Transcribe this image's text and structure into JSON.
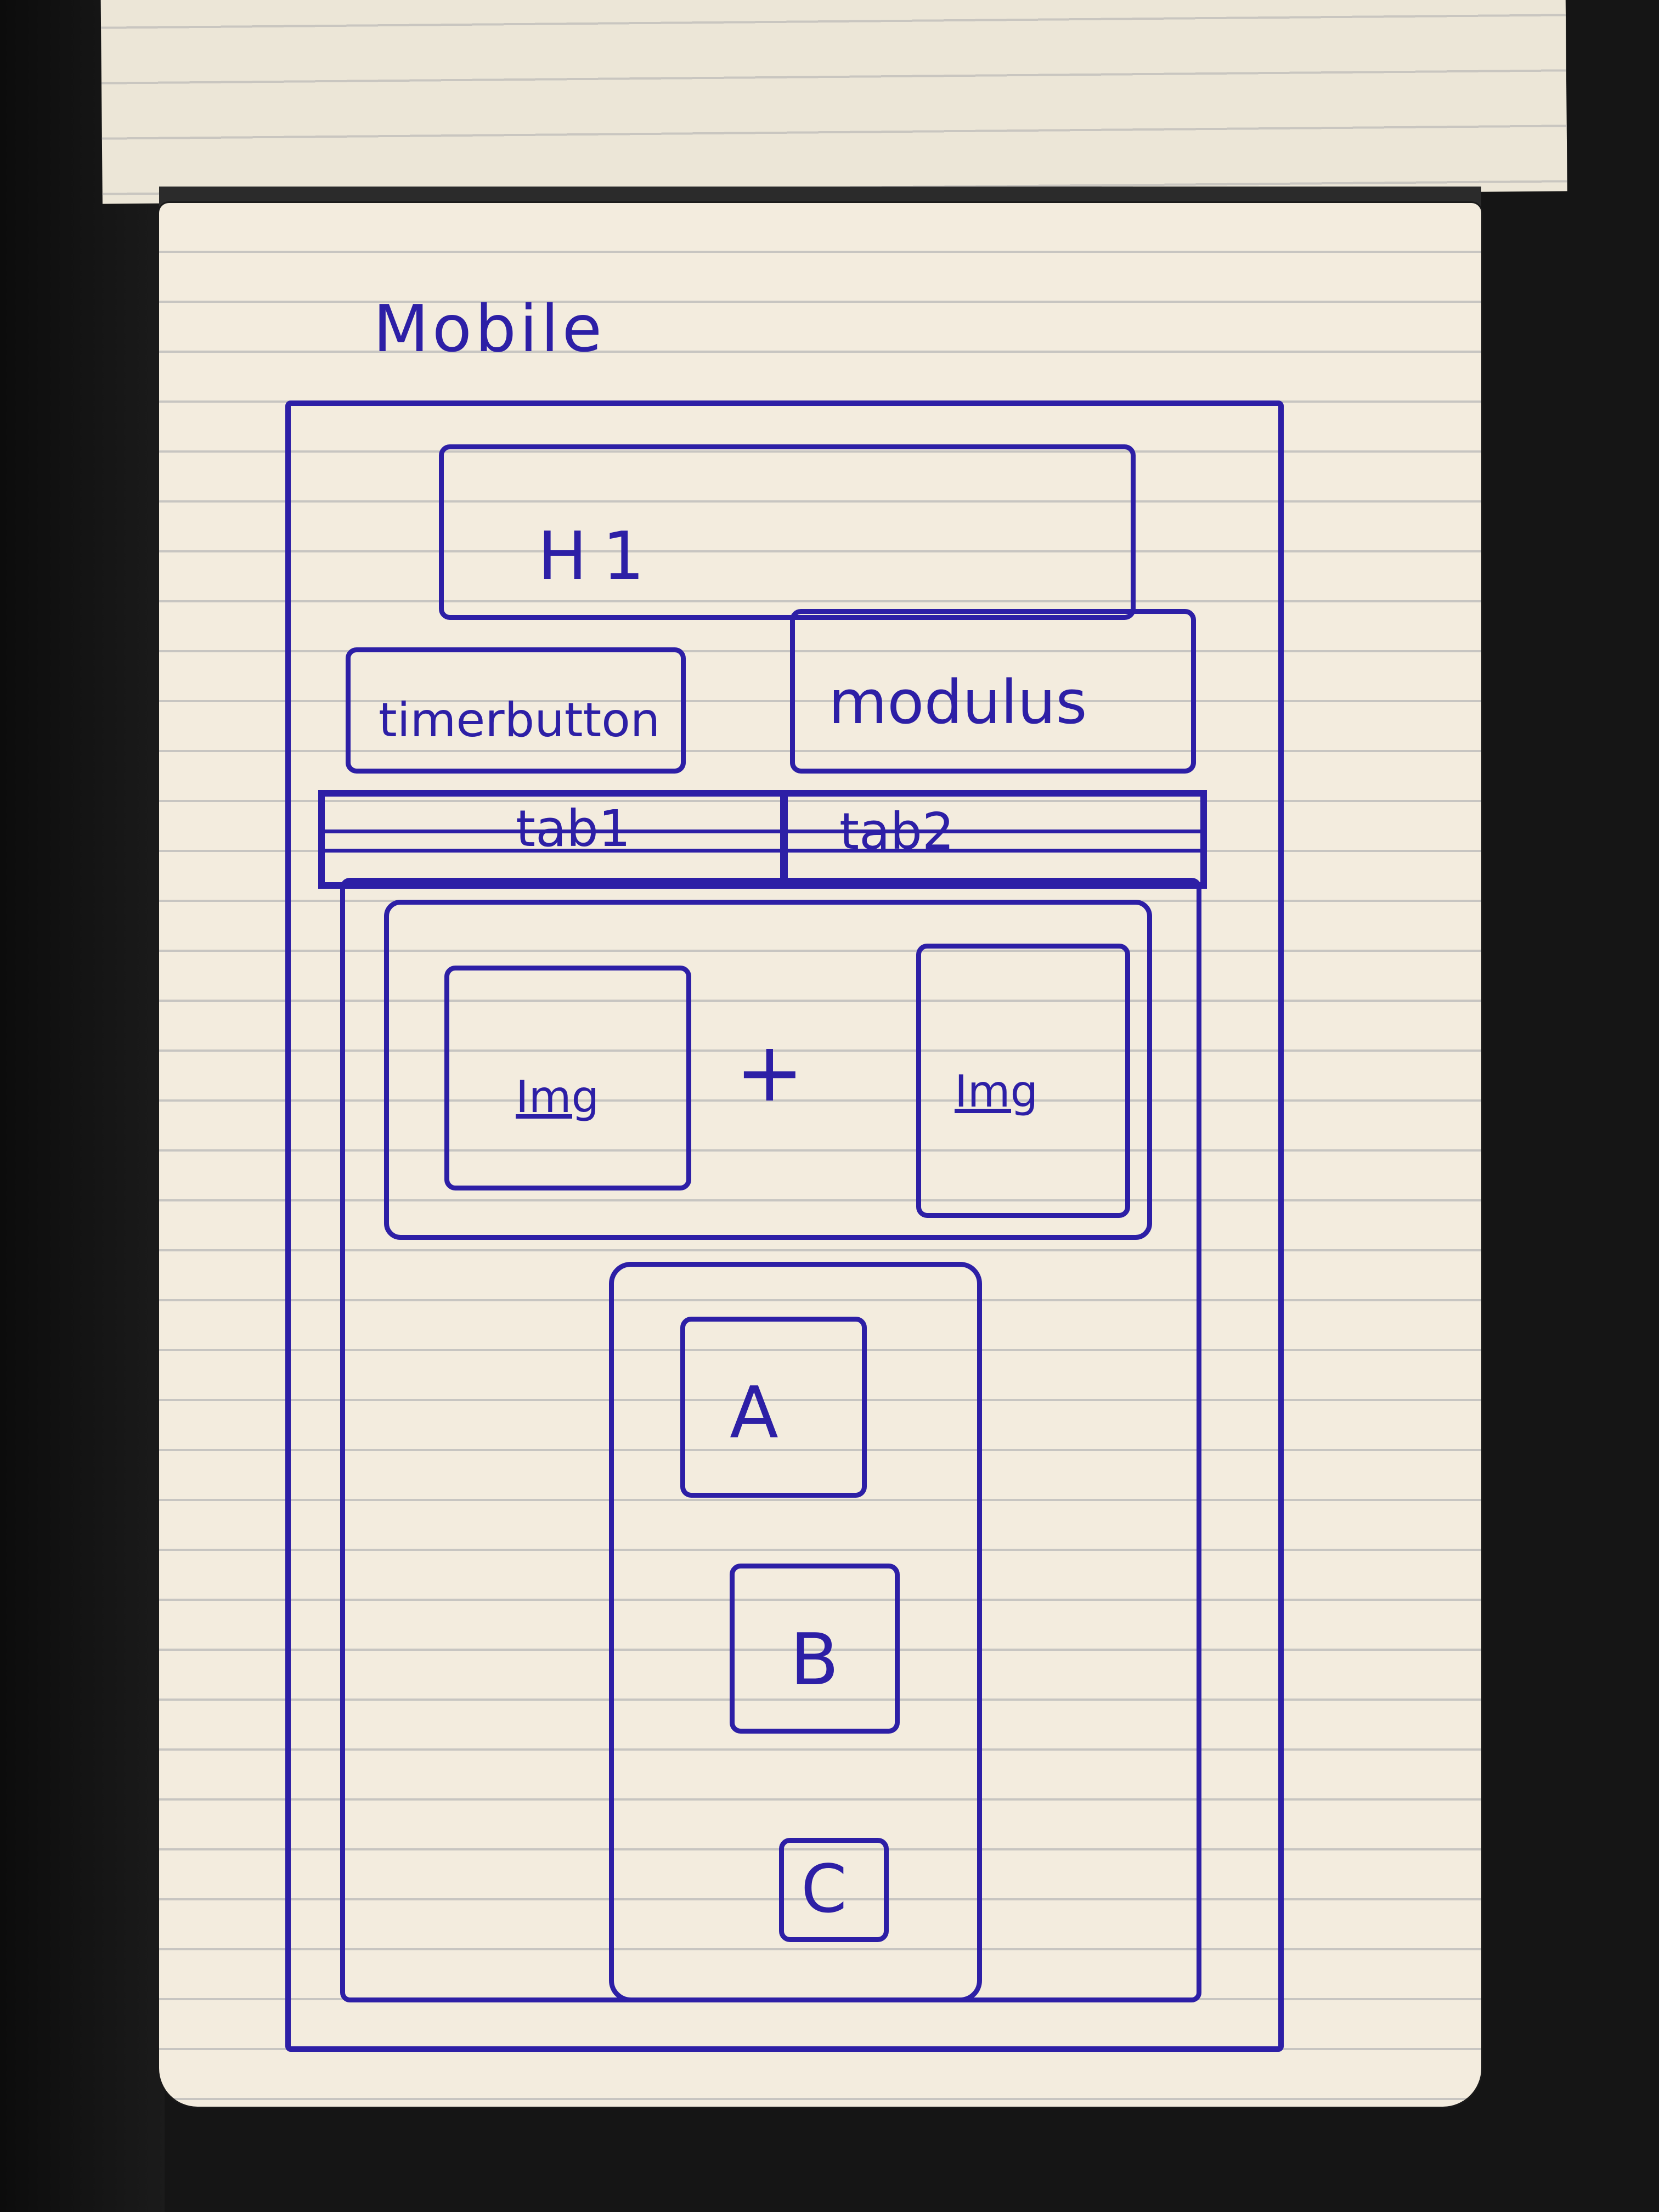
{
  "sketch": {
    "title": "Mobile",
    "header": {
      "label": "H1"
    },
    "buttons": [
      {
        "label": "timerbutton"
      },
      {
        "label": "modulus"
      }
    ],
    "tabs": [
      {
        "label": "tab1"
      },
      {
        "label": "tab2"
      }
    ],
    "image_row": {
      "left_label": "Img",
      "operator": "+",
      "right_label": "Img"
    },
    "options": [
      {
        "label": "A"
      },
      {
        "label": "B"
      },
      {
        "label": "C"
      }
    ]
  },
  "colors": {
    "ink": "#2d1fa6",
    "paper": "#f3ecde",
    "rule_line": "#c7c5c1",
    "background": "#151515"
  }
}
